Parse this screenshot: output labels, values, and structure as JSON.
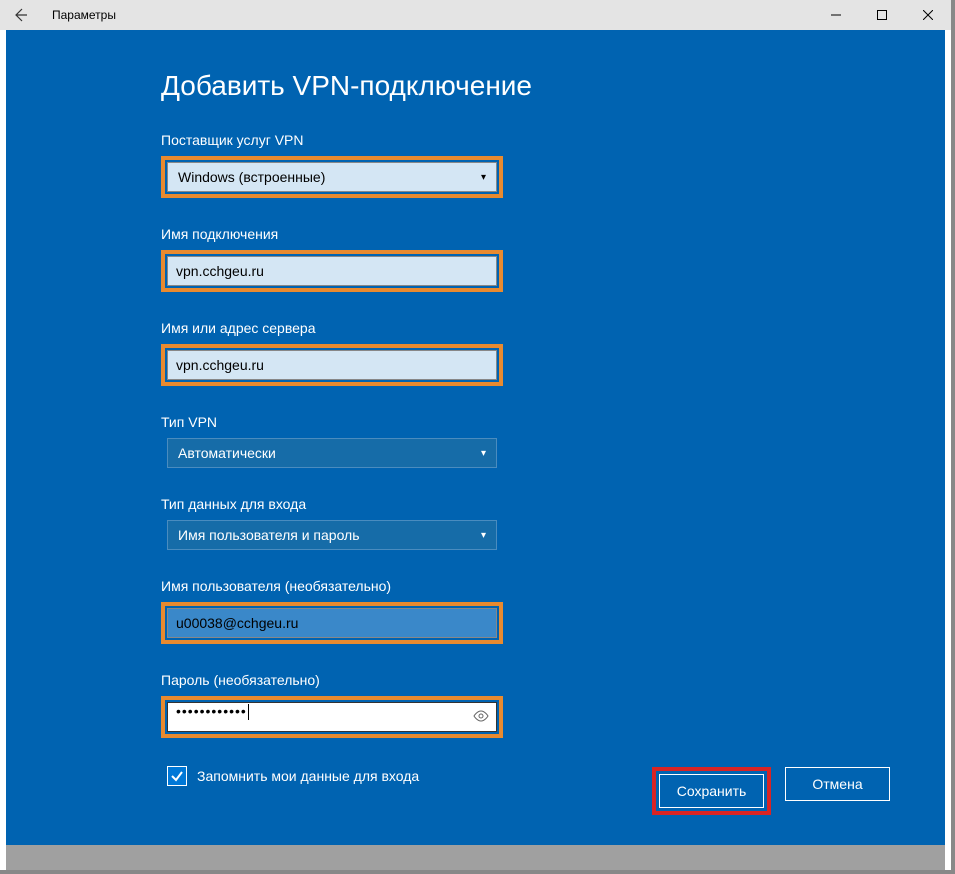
{
  "titlebar": {
    "title": "Параметры"
  },
  "modal": {
    "heading": "Добавить VPN-подключение",
    "provider_label": "Поставщик услуг VPN",
    "provider_value": "Windows (встроенные)",
    "conn_name_label": "Имя подключения",
    "conn_name_value": "vpn.cchgeu.ru",
    "server_label": "Имя или адрес сервера",
    "server_value": "vpn.cchgeu.ru",
    "vpn_type_label": "Тип VPN",
    "vpn_type_value": "Автоматически",
    "signin_type_label": "Тип данных для входа",
    "signin_type_value": "Имя пользователя и пароль",
    "username_label": "Имя пользователя (необязательно)",
    "username_value": "u00038@cchgeu.ru",
    "password_label": "Пароль (необязательно)",
    "password_masked": "••••••••••••",
    "remember_label": "Запомнить мои данные для входа",
    "save_btn": "Сохранить",
    "cancel_btn": "Отмена"
  }
}
